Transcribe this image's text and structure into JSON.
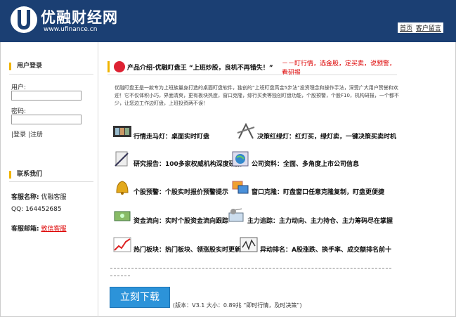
{
  "header": {
    "logo_text": "优融财经网",
    "logo_url": "www.ufinance.cn",
    "links": [
      "首页",
      "客户留言"
    ]
  },
  "sidebar": {
    "login": {
      "title": "用户登录",
      "user_label": "用户:",
      "password_label": "密码:",
      "login_link": "登录",
      "register_link": "注册",
      "separator": "|"
    },
    "contact": {
      "title": "联系我们",
      "name_label": "客服名称:",
      "name_value": "优融客服",
      "qq_label": "QQ:",
      "qq_value": "164452685",
      "email_label": "客服邮箱:",
      "email_value": "致信客服"
    }
  },
  "main": {
    "product_title": "产品介绍-优融盯盘王 “上班炒股，良机不再错失！”",
    "product_slogan": "－－盯行情，选金股，定买卖，说预警，看研报",
    "intro": "优融盯盘王是一款专为上班族量身打造的桌面盯盘软件，独创的“上班盯盘高金5步法”投资理念和操作手法，深受广大用户赞誉和欢迎！它不仅体积小巧，界面清爽，更有板块热度，窗口克隆，综行买卖等独创盯盘功能，个股预警，个股F10，机构研报，一个都不少，让您边工作边盯盘，上班投资两不误！",
    "features": [
      {
        "icon": "film-icon",
        "text": "行情走马灯：桌面实时盯盘"
      },
      {
        "icon": "compass-icon",
        "text": "决策红绿灯：红灯买，绿灯卖，一键决策买卖时机"
      },
      {
        "icon": "pen-icon",
        "text": "研究报告：100多家权威机构深度研报"
      },
      {
        "icon": "globe-icon",
        "text": "公司资料：全面、多角度上市公司信息"
      },
      {
        "icon": "bell-icon",
        "text": "个股预警：个股实时报价预警提示"
      },
      {
        "icon": "window-icon",
        "text": "窗口克隆：盯盘窗口任意克隆复制，盯盘更便捷"
      },
      {
        "icon": "money-icon",
        "text": "资金流向：实时个股资金流向跟踪"
      },
      {
        "icon": "satellite-icon",
        "text": "主力追踪：主力动向、主力持仓、主力筹码尽在掌握"
      },
      {
        "icon": "chart-icon",
        "text": "热门板块：热门板块、领涨股实时更新"
      },
      {
        "icon": "ranking-icon",
        "text": "异动排名：A股涨跌、换手率、成交额排名前十"
      }
    ],
    "download_button": "立刻下载",
    "download_info": "(版本：V3.1 大小：0.89兆 “即时行情，及时决策”)"
  },
  "colors": {
    "header_bg": "#1b3f73",
    "accent": "#f0b400",
    "slogan": "#d00000",
    "button": "#2c93d9"
  }
}
